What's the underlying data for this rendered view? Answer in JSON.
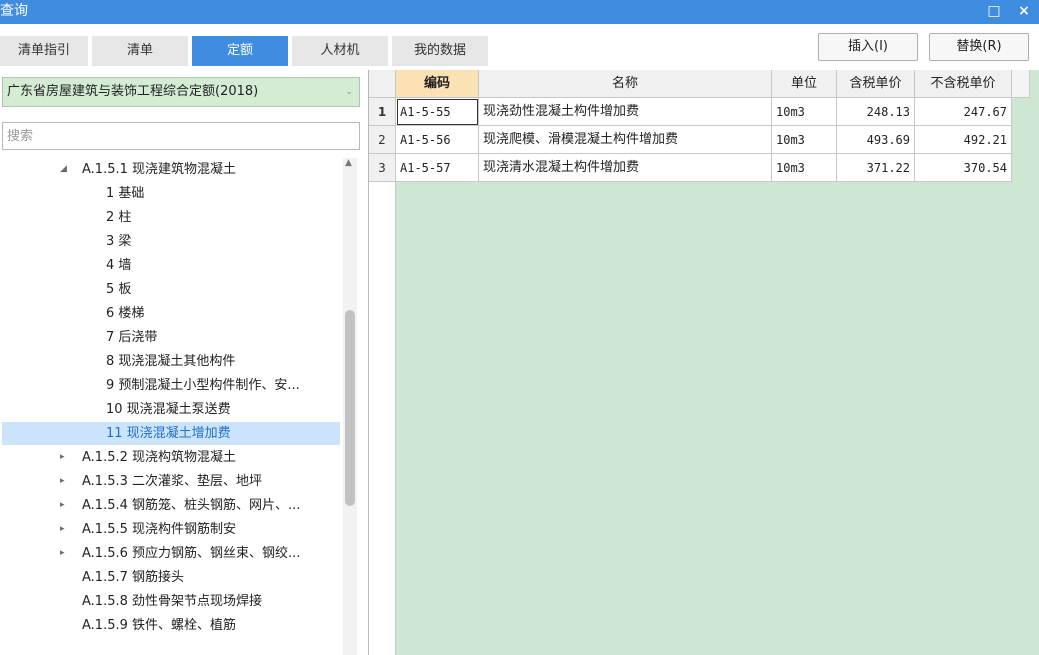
{
  "window": {
    "title": "查询",
    "maximize_glyph": "□",
    "close_glyph": "×"
  },
  "tabs": [
    {
      "label": "清单指引",
      "active": false
    },
    {
      "label": "清单",
      "active": false
    },
    {
      "label": "定额",
      "active": true
    },
    {
      "label": "人材机",
      "active": false
    },
    {
      "label": "我的数据",
      "active": false
    }
  ],
  "toolbar": {
    "insert_label": "插入(I)",
    "replace_label": "替换(R)"
  },
  "library": {
    "selected": "广东省房屋建筑与装饰工程综合定额(2018)",
    "arrow_glyph": "⌄"
  },
  "search": {
    "placeholder": "搜索",
    "value": ""
  },
  "tree": {
    "items": [
      {
        "label": "A.1.5.1 现浇建筑物混凝土",
        "toggle": "◢",
        "level": 1,
        "selected": false
      },
      {
        "label": "1 基础",
        "toggle": "",
        "level": 2,
        "selected": false
      },
      {
        "label": "2 柱",
        "toggle": "",
        "level": 2,
        "selected": false
      },
      {
        "label": "3 梁",
        "toggle": "",
        "level": 2,
        "selected": false
      },
      {
        "label": "4 墙",
        "toggle": "",
        "level": 2,
        "selected": false
      },
      {
        "label": "5 板",
        "toggle": "",
        "level": 2,
        "selected": false
      },
      {
        "label": "6 楼梯",
        "toggle": "",
        "level": 2,
        "selected": false
      },
      {
        "label": "7 后浇带",
        "toggle": "",
        "level": 2,
        "selected": false
      },
      {
        "label": "8 现浇混凝土其他构件",
        "toggle": "",
        "level": 2,
        "selected": false
      },
      {
        "label": "9 预制混凝土小型构件制作、安...",
        "toggle": "",
        "level": 2,
        "selected": false
      },
      {
        "label": "10 现浇混凝土泵送费",
        "toggle": "",
        "level": 2,
        "selected": false
      },
      {
        "label": "11 现浇混凝土增加费",
        "toggle": "",
        "level": 2,
        "selected": true
      },
      {
        "label": "A.1.5.2 现浇构筑物混凝土",
        "toggle": "▸",
        "level": 1,
        "selected": false
      },
      {
        "label": "A.1.5.3 二次灌浆、垫层、地坪",
        "toggle": "▸",
        "level": 1,
        "selected": false
      },
      {
        "label": "A.1.5.4 钢筋笼、桩头钢筋、网片、...",
        "toggle": "▸",
        "level": 1,
        "selected": false
      },
      {
        "label": "A.1.5.5 现浇构件钢筋制安",
        "toggle": "▸",
        "level": 1,
        "selected": false
      },
      {
        "label": "A.1.5.6 预应力钢筋、钢丝束、钢绞...",
        "toggle": "▸",
        "level": 1,
        "selected": false
      },
      {
        "label": "A.1.5.7 钢筋接头",
        "toggle": "",
        "level": 1,
        "selected": false
      },
      {
        "label": "A.1.5.8 劲性骨架节点现场焊接",
        "toggle": "",
        "level": 1,
        "selected": false
      },
      {
        "label": "A.1.5.9 铁件、螺栓、植筋",
        "toggle": "",
        "level": 1,
        "selected": false
      }
    ],
    "scroll_up_glyph": "▲"
  },
  "table": {
    "headers": {
      "code": "编码",
      "name": "名称",
      "unit": "单位",
      "price_tax": "含税单价",
      "price_notax": "不含税单价"
    },
    "rows": [
      {
        "no": "1",
        "code": "A1-5-55",
        "name": "现浇劲性混凝土构件增加费",
        "unit": "10m3",
        "price_tax": "248.13",
        "price_notax": "247.67"
      },
      {
        "no": "2",
        "code": "A1-5-56",
        "name": "现浇爬模、滑模混凝土构件增加费",
        "unit": "10m3",
        "price_tax": "493.69",
        "price_notax": "492.21"
      },
      {
        "no": "3",
        "code": "A1-5-57",
        "name": "现浇清水混凝土构件增加费",
        "unit": "10m3",
        "price_tax": "371.22",
        "price_notax": "370.54"
      }
    ]
  },
  "colors": {
    "title_bar": "#3f8de0",
    "grid_background": "#cde7d3",
    "selected_tree_item": "#cce4fb",
    "code_header": "#fbe2b5"
  }
}
